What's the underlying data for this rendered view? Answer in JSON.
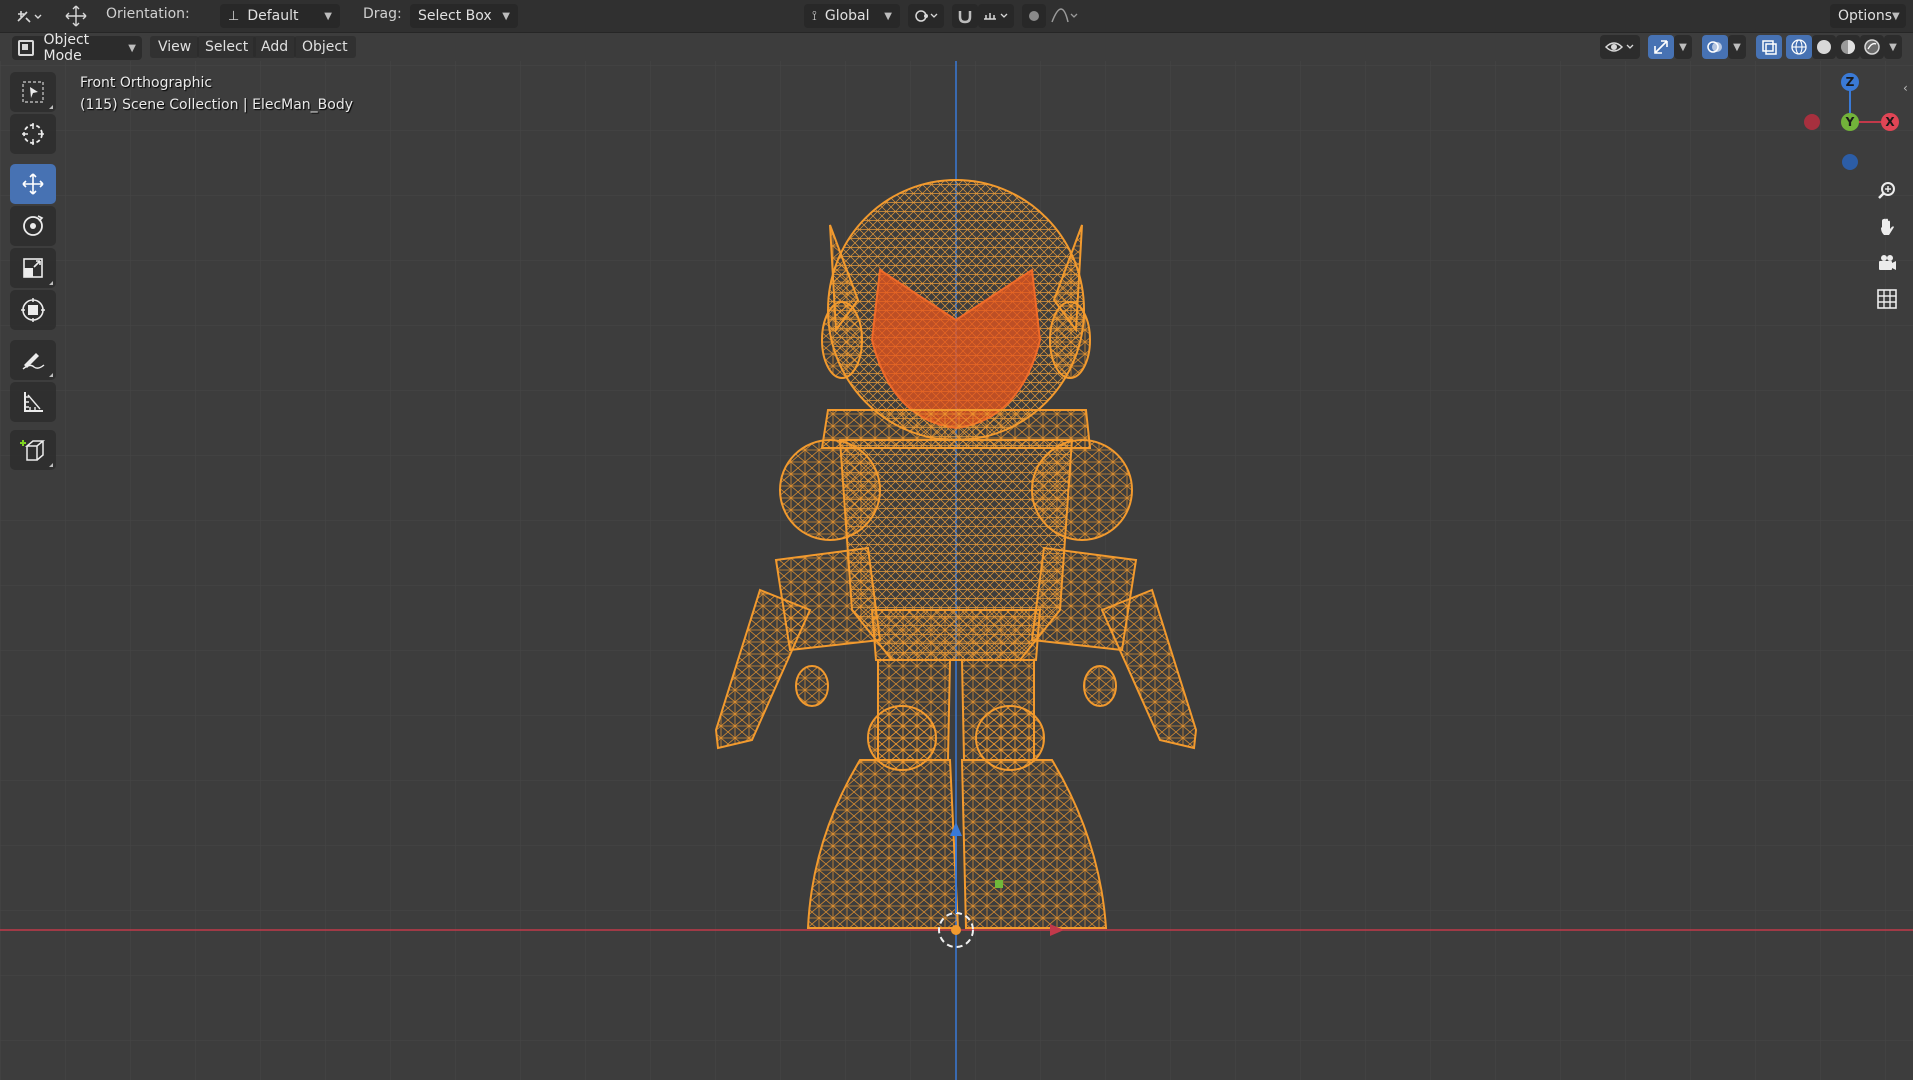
{
  "header": {
    "orientation_label": "Orientation:",
    "orientation_value": "Default",
    "drag_label": "Drag:",
    "drag_value": "Select Box",
    "transform_space": "Global",
    "options_label": "Options"
  },
  "toolbar": {
    "mode": "Object Mode",
    "menus": [
      "View",
      "Select",
      "Add",
      "Object"
    ]
  },
  "viewport": {
    "view_name": "Front Orthographic",
    "collection_line": "(115) Scene Collection | ElecMan_Body"
  },
  "gizmo": {
    "z_label": "Z",
    "y_label": "Y",
    "x_label": "X"
  },
  "tools": [
    {
      "name": "select-box-tool",
      "icon": "cursor-arrow",
      "active": false
    },
    {
      "name": "cursor-tool",
      "icon": "3d-cursor",
      "active": false
    },
    {
      "name": "move-tool",
      "icon": "move-arrows",
      "active": true
    },
    {
      "name": "rotate-tool",
      "icon": "rotate",
      "active": false
    },
    {
      "name": "scale-tool",
      "icon": "scale",
      "active": false
    },
    {
      "name": "transform-tool",
      "icon": "transform",
      "active": false
    },
    {
      "name": "annotate-tool",
      "icon": "pencil",
      "active": false
    },
    {
      "name": "measure-tool",
      "icon": "ruler",
      "active": false
    },
    {
      "name": "add-cube-tool",
      "icon": "cube-plus",
      "active": false
    }
  ],
  "colors": {
    "background": "#3d3d3d",
    "grid_line": "#474747",
    "wireframe": "#f29a2e",
    "face_highlight": "#e8551e",
    "x_axis": "#c2394a",
    "z_axis": "#3a7ad6",
    "active_tool": "#4772b3"
  }
}
